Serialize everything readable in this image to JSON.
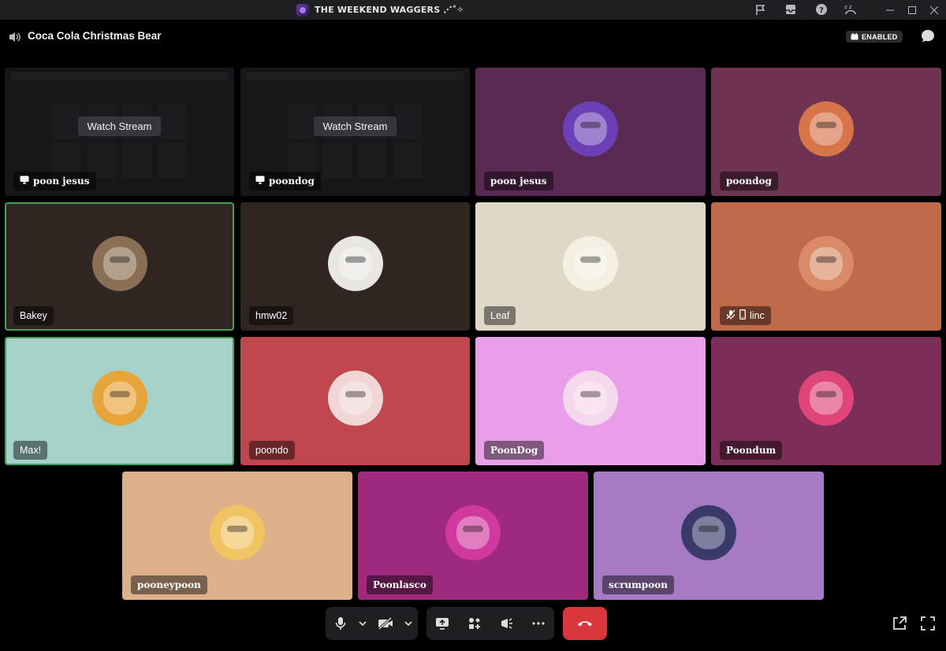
{
  "titlebar": {
    "server_title": "THE WEEKEND WAGGERS ⋰˚✧",
    "icons": [
      "flag-icon",
      "inbox-icon",
      "help-icon",
      "sleep-icon"
    ],
    "window_controls": [
      "minimize-icon",
      "maximize-icon",
      "close-icon"
    ]
  },
  "header": {
    "channel_icon": "speaker-icon",
    "channel_name": "Coca Cola Christmas Bear",
    "badge_label": "ENABLED",
    "chat_icon": "chat-bubble-icon"
  },
  "stream_button_label": "Watch Stream",
  "tiles": [
    {
      "name": "poon jesus",
      "kind": "stream",
      "bg": "#2b2d31"
    },
    {
      "name": "poondog",
      "kind": "stream",
      "bg": "#2b2d31"
    },
    {
      "name": "poon jesus",
      "kind": "avatar",
      "bg": "#5a2a55",
      "avatar": "#6b3fb5"
    },
    {
      "name": "poondog",
      "kind": "avatar",
      "bg": "#6e3350",
      "avatar": "#d8744a"
    },
    {
      "name": "Bakey",
      "kind": "avatar",
      "bg": "#2f2622",
      "avatar": "#8b6f55",
      "speaking": true
    },
    {
      "name": "hmw02",
      "kind": "avatar",
      "bg": "#2f2622",
      "avatar": "#e9e6e2"
    },
    {
      "name": "Leaf",
      "kind": "avatar",
      "bg": "#e0d8c6",
      "avatar": "#f3efe2"
    },
    {
      "name": "linc",
      "kind": "avatar",
      "bg": "#c06a4c",
      "avatar": "#d98a66",
      "status": "muted-mobile"
    },
    {
      "name": "Max!",
      "kind": "avatar",
      "bg": "#a6d1c8",
      "avatar": "#e6a43a",
      "speaking": true
    },
    {
      "name": "poondo",
      "kind": "avatar",
      "bg": "#c1474f",
      "avatar": "#f0d6d6"
    },
    {
      "name": "PoonDog",
      "kind": "avatar",
      "bg": "#e89ee8",
      "avatar": "#f6d8ec"
    },
    {
      "name": "Poondum",
      "kind": "avatar",
      "bg": "#7d2e58",
      "avatar": "#e0457a"
    },
    {
      "name": "pooneypoon",
      "kind": "avatar",
      "bg": "#ddb08a",
      "avatar": "#f0c460"
    },
    {
      "name": "Poonlasco",
      "kind": "avatar",
      "bg": "#9e2a80",
      "avatar": "#d2399e"
    },
    {
      "name": "scrumpoon",
      "kind": "avatar",
      "bg": "#a77ac4",
      "avatar": "#3a3a6a"
    }
  ],
  "controls": {
    "mic_icon": "microphone-icon",
    "camera_icon": "camera-off-icon",
    "share_icon": "screen-share-icon",
    "activities_icon": "activities-icon",
    "soundboard_icon": "soundboard-icon",
    "more_icon": "more-icon",
    "hangup_icon": "hang-up-icon",
    "popout_icon": "pop-out-icon",
    "fullscreen_icon": "fullscreen-icon"
  }
}
